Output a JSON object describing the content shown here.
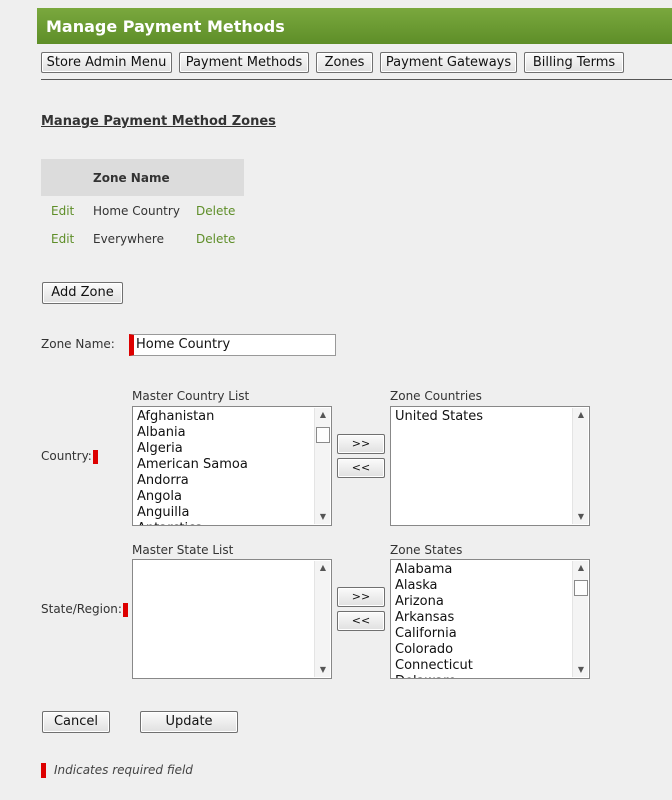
{
  "header": {
    "title": "Manage Payment Methods"
  },
  "tabs": [
    "Store Admin Menu",
    "Payment Methods",
    "Zones",
    "Payment Gateways",
    "Billing Terms"
  ],
  "section_title": "Manage Payment Method Zones",
  "zone_table": {
    "header": "Zone Name",
    "rows": [
      {
        "edit": "Edit",
        "name": "Home Country",
        "delete": "Delete"
      },
      {
        "edit": "Edit",
        "name": "Everywhere",
        "delete": "Delete"
      }
    ]
  },
  "add_zone_label": "Add Zone",
  "form": {
    "zone_name_label": "Zone Name:",
    "zone_name_value": "Home Country",
    "country_label": "Country:",
    "master_country_title": "Master Country List",
    "master_countries": [
      "Afghanistan",
      "Albania",
      "Algeria",
      "American Samoa",
      "Andorra",
      "Angola",
      "Anguilla",
      "Antarctica"
    ],
    "zone_countries_title": "Zone Countries",
    "zone_countries": [
      "United States"
    ],
    "state_label": "State/Region:",
    "master_state_title": "Master State List",
    "master_states": [],
    "zone_states_title": "Zone States",
    "zone_states": [
      "Alabama",
      "Alaska",
      "Arizona",
      "Arkansas",
      "California",
      "Colorado",
      "Connecticut",
      "Delaware"
    ],
    "add_arrow": ">>",
    "remove_arrow": "<<"
  },
  "cancel_label": "Cancel",
  "update_label": "Update",
  "legend_text": "Indicates required field",
  "colors": {
    "header_green": "#6a9a31",
    "link_green": "#5e8e28",
    "required_red": "#dd0000"
  }
}
